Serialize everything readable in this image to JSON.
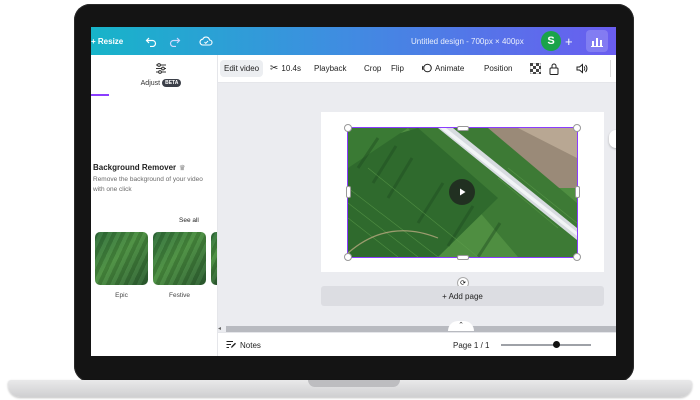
{
  "topbar": {
    "resize_label": "+ Resize",
    "title": "Untitled design - 700px × 400px",
    "avatar_letter": "S",
    "plus": "+"
  },
  "left_panel": {
    "adjust_label": "Adjust",
    "beta_badge": "BETA",
    "bg_remover_title": "Background Remover",
    "bg_remover_desc": "Remove the background of your video with one click",
    "see_all": "See all",
    "thumbnails": [
      {
        "label": "Epic"
      },
      {
        "label": "Festive"
      },
      {
        "label": ""
      }
    ]
  },
  "toolbar": {
    "edit_video": "Edit video",
    "duration": "10.4s",
    "playback": "Playback",
    "crop": "Crop",
    "flip": "Flip",
    "animate": "Animate",
    "position": "Position"
  },
  "canvas": {
    "add_page": "+ Add page"
  },
  "bottom_bar": {
    "notes": "Notes",
    "page_indicator": "Page 1 / 1"
  },
  "colors": {
    "accent": "#8b3dff",
    "avatar": "#1aa34a",
    "topbar_start": "#17b4c9",
    "topbar_end": "#6a5df0"
  }
}
